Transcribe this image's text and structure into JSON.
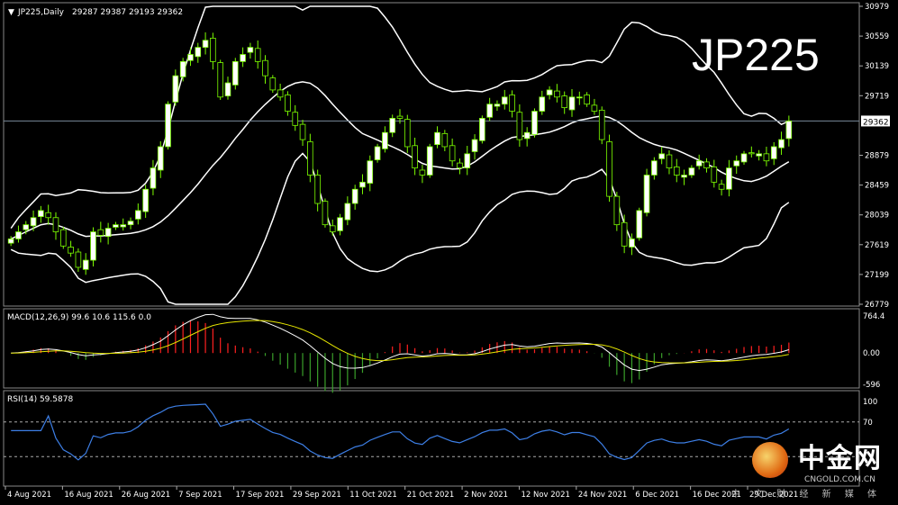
{
  "header": {
    "symbol_label": "JP225,Daily",
    "ohlc": "29287 29387 29193 29362"
  },
  "big_title": "JP225",
  "watermark": {
    "cn": "中金网",
    "url": "CNGOLD.COM.CN",
    "tagline": "中 文 财 经 新 媒 体"
  },
  "colors": {
    "grid_border": "#ffffff",
    "bull": "#ffffff",
    "bear": "#000000",
    "candle_outline": "#7CFC00",
    "band": "#ffffff",
    "macd_pos": "#ff2020",
    "macd_neg": "#3aa02a",
    "macd_line": "#ffffff",
    "signal_line": "#e6e600",
    "rsi_line": "#3d7fe6",
    "price_line": "#778899"
  },
  "chart_data": [
    {
      "type": "candlestick",
      "title": "JP225,Daily 29287 29387 29193 29362",
      "last_price": 29362,
      "price_axis_ticks": [
        30979,
        30559,
        30139,
        29719,
        29299,
        28879,
        28459,
        28039,
        27619,
        27199,
        26779
      ],
      "ylim": [
        26779,
        30979
      ],
      "x_tick_labels": [
        "4 Aug 2021",
        "16 Aug 2021",
        "26 Aug 2021",
        "7 Sep 2021",
        "17 Sep 2021",
        "29 Sep 2021",
        "11 Oct 2021",
        "21 Oct 2021",
        "2 Nov 2021",
        "12 Nov 2021",
        "24 Nov 2021",
        "6 Dec 2021",
        "16 Dec 2021",
        "29 Dec 2021"
      ],
      "closes": [
        27700,
        27800,
        27900,
        28000,
        28100,
        28000,
        27800,
        27600,
        27500,
        27300,
        27400,
        27800,
        27750,
        27850,
        27900,
        27900,
        27950,
        28100,
        28400,
        28700,
        29000,
        29600,
        30000,
        30200,
        30300,
        30400,
        30500,
        30200,
        29700,
        29900,
        30200,
        30300,
        30400,
        30200,
        30000,
        29800,
        29700,
        29500,
        29300,
        29100,
        28600,
        28200,
        27900,
        27800,
        28000,
        28200,
        28400,
        28500,
        28800,
        29000,
        29200,
        29400,
        29400,
        29000,
        28700,
        28600,
        29000,
        29200,
        29000,
        28800,
        28700,
        28900,
        29100,
        29400,
        29600,
        29600,
        29700,
        29500,
        29100,
        29200,
        29500,
        29700,
        29800,
        29700,
        29550,
        29700,
        29700,
        29600,
        29500,
        29100,
        28300,
        27900,
        27600,
        27700,
        28100,
        28600,
        28800,
        28900,
        28700,
        28600,
        28600,
        28700,
        28800,
        28700,
        28500,
        28400,
        28700,
        28800,
        28900,
        28900,
        28900,
        28800,
        29000,
        29100,
        29362
      ]
    },
    {
      "type": "line",
      "title": "MACD(12,26,9) 99.6 10.6 115.6 0.0",
      "y_axis_ticks": [
        764.4,
        0.0,
        -596
      ],
      "ylim": [
        -596,
        764.4
      ],
      "series": [
        {
          "name": "MACD histogram",
          "type": "bar"
        },
        {
          "name": "MACD"
        },
        {
          "name": "Signal"
        }
      ]
    },
    {
      "type": "line",
      "title": "RSI(14) 59.5878",
      "y_axis_ticks": [
        100,
        70,
        30,
        0
      ],
      "ylim": [
        0,
        100
      ],
      "levels": [
        70,
        30
      ],
      "series": [
        {
          "name": "RSI(14)"
        }
      ]
    }
  ]
}
